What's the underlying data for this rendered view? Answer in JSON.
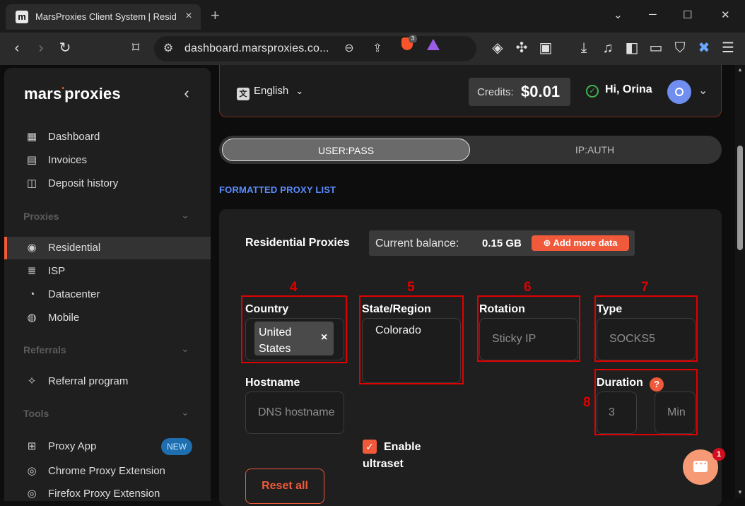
{
  "browser": {
    "tab_title": "MarsProxies Client System | Residential",
    "tab_favicon": "m",
    "url": "dashboard.marsproxies.co...",
    "shields_count": "3",
    "newtab_label": "+",
    "tab_close": "×",
    "win_min": "─",
    "win_max": "☐",
    "win_close": "✕",
    "list_chev": "⌄"
  },
  "sidebar": {
    "logo_a": "mars",
    "logo_dot": "•",
    "logo_b": "proxies",
    "collapse": "‹",
    "items_main": [
      {
        "label": "Dashboard",
        "icon": "dashboard-icon",
        "glyph": "▦"
      },
      {
        "label": "Invoices",
        "icon": "invoice-icon",
        "glyph": "▤"
      },
      {
        "label": "Deposit history",
        "icon": "deposit-history-icon",
        "glyph": "◫"
      }
    ],
    "proxies_header": "Proxies",
    "items_proxies": [
      {
        "label": "Residential",
        "icon": "location-pin-icon",
        "glyph": "◉",
        "active": true
      },
      {
        "label": "ISP",
        "icon": "server-icon",
        "glyph": "≣"
      },
      {
        "label": "Datacenter",
        "icon": "pie-icon",
        "glyph": "◔"
      },
      {
        "label": "Mobile",
        "icon": "mobile-pin-icon",
        "glyph": "◍"
      }
    ],
    "referrals_header": "Referrals",
    "referral_item": {
      "label": "Referral program",
      "glyph": "✧"
    },
    "tools_header": "Tools",
    "tools_items": [
      {
        "label": "Proxy App",
        "badge": "NEW",
        "glyph": "⊞"
      },
      {
        "label": "Chrome Proxy Extension",
        "glyph": "◎"
      },
      {
        "label": "Firefox Proxy Extension",
        "glyph": "◎"
      }
    ],
    "chevron": "⌄"
  },
  "header": {
    "language": "English",
    "lang_glyph": "文",
    "lang_chev": "⌄",
    "credits_label": "Credits:",
    "credits_value": "$0.01",
    "greeting": "Hi, Orina",
    "check": "✓",
    "user_chev": "⌄"
  },
  "auth_toggle": {
    "options": [
      "USER:PASS",
      "IP:AUTH"
    ],
    "selected": "USER:PASS"
  },
  "formatted_link": "FORMATTED PROXY LIST",
  "residential": {
    "title": "Residential Proxies",
    "balance_label": "Current balance:",
    "balance_value": "0.15 GB",
    "add_data": "⊕ Add more data"
  },
  "form": {
    "country": {
      "num": "4",
      "label": "Country",
      "value_line1": "United",
      "value_line2": "States",
      "remove": "×"
    },
    "state": {
      "num": "5",
      "label": "State/Region",
      "value": "Colorado",
      "enable_label": "Enable",
      "enable_label2": "ultraset",
      "enable_checked": true,
      "check": "✓"
    },
    "rotation": {
      "num": "6",
      "label": "Rotation",
      "placeholder": "Sticky IP"
    },
    "type": {
      "num": "7",
      "label": "Type",
      "placeholder": "SOCKS5"
    },
    "hostname": {
      "label": "Hostname",
      "placeholder": "DNS hostname"
    },
    "duration": {
      "num": "8",
      "label": "Duration",
      "help": "?",
      "value": "3",
      "unit": "Min"
    },
    "reset": "Reset all"
  },
  "chat": {
    "badge": "1"
  },
  "colors": {
    "accent": "#f05a3b",
    "link": "#5b8cff",
    "annotation": "#e00000"
  }
}
